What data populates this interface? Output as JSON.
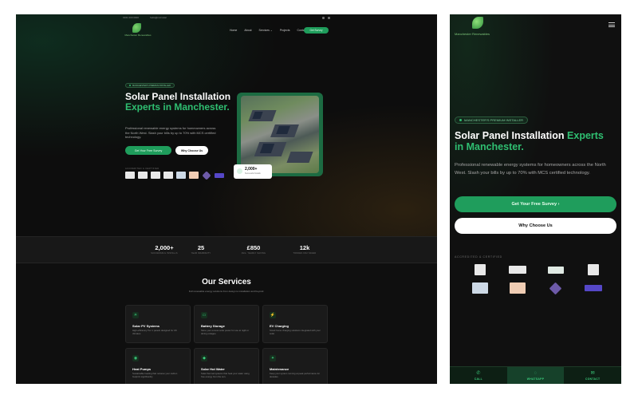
{
  "header": {
    "phone": "0161 000 0000",
    "email_short": "hello@mcrsolar",
    "logo_text": "Manchester Renewables",
    "nav": [
      "Home",
      "About",
      "Services ⌄",
      "Projects",
      "Contact"
    ],
    "cta": "Get Survey"
  },
  "hero": {
    "badge": "MANCHESTER'S PREMIUM INSTALLER",
    "title_main": "Solar Panel Installation",
    "title_accent_1": "Experts",
    "title_accent_2": "in Manchester.",
    "desc": "Professional renewable energy systems for homeowners across the North West. Slash your bills by up to 70% with MCS certified technology.",
    "btn_primary": "Get Your Free Survey",
    "btn_secondary": "Why Choose Us",
    "accredited_label": "ACCREDITED & CERTIFIED",
    "stat_card_value": "2,000+",
    "stat_card_label": "Successful Installs"
  },
  "stats": [
    {
      "value": "2,000+",
      "label": "SUCCESSFUL INSTALLS"
    },
    {
      "value": "25",
      "label": "YEAR WARRANTY"
    },
    {
      "value": "£850",
      "label": "AVG. YEARLY SAVING"
    },
    {
      "value": "12k",
      "label": "TONNES CO2 SAVED"
    }
  ],
  "services": {
    "title": "Our Services",
    "subtitle": "Full renewable energy solutions from design to installation and beyond.",
    "items": [
      {
        "title": "Solar PV Systems",
        "desc": "High-efficiency Tier 1 panels designed for UK climates.",
        "icon": "sun-icon"
      },
      {
        "title": "Battery Storage",
        "desc": "Store your excess solar power for use at night or during outages.",
        "icon": "battery-icon"
      },
      {
        "title": "EV Charging",
        "desc": "Smart home charging solutions integrated with your solar.",
        "icon": "plug-icon"
      },
      {
        "title": "Heat Pumps",
        "desc": "Sustainable heating that reduces your carbon footprint significantly.",
        "icon": "thermometer-icon"
      },
      {
        "title": "Solar Hot Water",
        "desc": "Solar thermal systems that heat your water using free energy from the sun.",
        "icon": "droplet-icon"
      },
      {
        "title": "Maintenance",
        "desc": "Keep your system running at peak performance for decades.",
        "icon": "wrench-icon"
      }
    ]
  },
  "mobile": {
    "badge": "MANCHESTER'S PREMIUM INSTALLER",
    "title_main": "Solar Panel Installation",
    "title_accent_1": "Experts",
    "title_accent_2": "in Manchester.",
    "desc": "Professional renewable energy systems for homeowners across the North West. Slash your bills by up to 70% with MCS certified technology.",
    "btn_primary": "Get Your Free Survey ›",
    "btn_secondary": "Why Choose Us",
    "accredited_label": "ACCREDITED & CERTIFIED",
    "bottom_nav": [
      {
        "label": "CALL",
        "icon": "phone-icon"
      },
      {
        "label": "WHATSAPP",
        "icon": "whatsapp-icon"
      },
      {
        "label": "CONTACT",
        "icon": "mail-icon"
      }
    ]
  },
  "colors": {
    "accent": "#2fbf71",
    "button_green": "#1f9d5c",
    "background": "#0f0f0f"
  }
}
